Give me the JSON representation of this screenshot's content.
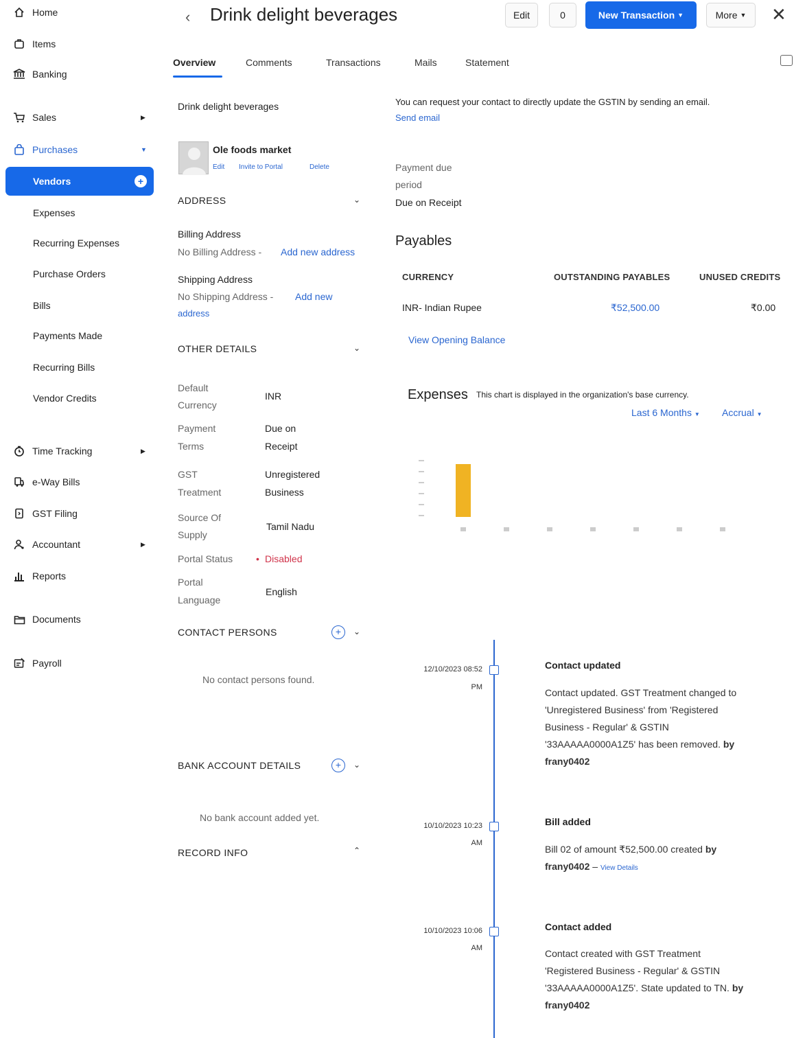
{
  "sidebar": {
    "items": [
      {
        "label": "Home",
        "icon": "home-icon"
      },
      {
        "label": "Items",
        "icon": "box-icon"
      },
      {
        "label": "Banking",
        "icon": "bank-icon"
      },
      {
        "label": "Sales",
        "icon": "cart-icon"
      },
      {
        "label": "Purchases",
        "icon": "bag-icon"
      },
      {
        "label": "Vendors"
      },
      {
        "label": "Expenses"
      },
      {
        "label": "Recurring Expenses"
      },
      {
        "label": "Purchase Orders"
      },
      {
        "label": "Bills"
      },
      {
        "label": "Payments Made"
      },
      {
        "label": "Recurring Bills"
      },
      {
        "label": "Vendor Credits"
      },
      {
        "label": "Time Tracking",
        "icon": "clock-icon"
      },
      {
        "label": "e-Way Bills",
        "icon": "truck-icon"
      },
      {
        "label": "GST Filing",
        "icon": "file-icon"
      },
      {
        "label": "Accountant",
        "icon": "person-icon"
      },
      {
        "label": "Reports",
        "icon": "bar-chart-icon"
      },
      {
        "label": "Documents",
        "icon": "folder-icon"
      },
      {
        "label": "Payroll",
        "icon": "payroll-icon"
      }
    ]
  },
  "header": {
    "title": "Drink delight beverages",
    "edit_label": "Edit",
    "attach_label": "0",
    "new_transaction_label": "New Transaction",
    "more_label": "More"
  },
  "tabs": [
    "Overview",
    "Comments",
    "Transactions",
    "Mails",
    "Statement"
  ],
  "profile": {
    "company": "Drink delight beverages",
    "contact_name": "Ole foods market",
    "actions": [
      "Edit",
      "Invite to Portal",
      "Delete"
    ]
  },
  "address": {
    "heading": "ADDRESS",
    "billing_label": "Billing Address",
    "billing_none": "No Billing Address -",
    "billing_add": "Add new address",
    "shipping_label": "Shipping Address",
    "shipping_none": "No Shipping Address -",
    "shipping_add_1": "Add new",
    "shipping_add_2": "address"
  },
  "other_details": {
    "heading": "OTHER DETAILS",
    "rows": [
      {
        "label1": "Default",
        "label2": "Currency",
        "value1": "INR",
        "value2": ""
      },
      {
        "label1": "Payment",
        "label2": "Terms",
        "value1": "Due on",
        "value2": "Receipt"
      },
      {
        "label1": "GST",
        "label2": "Treatment",
        "value1": "Unregistered",
        "value2": "Business"
      },
      {
        "label1": "Source Of",
        "label2": "Supply",
        "value1": "Tamil Nadu",
        "value2": ""
      },
      {
        "label1": "Portal Status",
        "label2": "",
        "value1": "Disabled",
        "value2": ""
      },
      {
        "label1": "Portal",
        "label2": "Language",
        "value1": "English",
        "value2": ""
      }
    ]
  },
  "contact_persons": {
    "heading": "CONTACT PERSONS",
    "empty": "No contact persons found."
  },
  "bank_accounts": {
    "heading": "BANK ACCOUNT DETAILS",
    "empty": "No bank account added yet."
  },
  "record_info": {
    "heading": "RECORD INFO"
  },
  "gstin_notice": {
    "text": "You can request your contact to directly update the GSTIN by sending an email.",
    "link": "Send email"
  },
  "payment_due": {
    "label1": "Payment due",
    "label2": "period",
    "value": "Due on Receipt"
  },
  "payables": {
    "heading": "Payables",
    "columns": [
      "CURRENCY",
      "OUTSTANDING PAYABLES",
      "UNUSED CREDITS"
    ],
    "row": {
      "currency": "INR- Indian Rupee",
      "outstanding": "₹52,500.00",
      "unused": "₹0.00"
    },
    "opening_balance_link": "View Opening Balance"
  },
  "expenses": {
    "heading": "Expenses",
    "note": "This chart is displayed in the organization's base currency.",
    "period_filter": "Last 6 Months",
    "basis_filter": "Accrual"
  },
  "chart_data": {
    "type": "bar",
    "categories": [
      "",
      "",
      "",
      "",
      "",
      "",
      ""
    ],
    "values": [
      52500,
      0,
      0,
      0,
      0,
      0,
      0
    ],
    "color": "#f0b323",
    "ylim": [
      0,
      60000
    ],
    "grid": false
  },
  "timeline": [
    {
      "date1": "12/10/2023 08:52",
      "date2": "PM",
      "title": "Contact updated",
      "body": "Contact updated. GST Treatment changed to 'Unregistered Business' from 'Registered Business - Regular' & GSTIN '33AAAAA0000A1Z5' has been removed.",
      "by": "by frany0402"
    },
    {
      "date1": "10/10/2023 10:23",
      "date2": "AM",
      "title": "Bill added",
      "body": "Bill 02 of amount ₹52,500.00 created",
      "by": "by frany0402",
      "link": "View Details"
    },
    {
      "date1": "10/10/2023 10:06",
      "date2": "AM",
      "title": "Contact added",
      "body": "Contact created with GST Treatment 'Registered Business - Regular' & GSTIN '33AAAAA0000A1Z5'. State updated to TN.",
      "by": "by frany0402"
    }
  ],
  "colors": {
    "accent": "#1769e8",
    "link": "#2a66d0",
    "danger": "#d0334a",
    "bar": "#f0b323"
  }
}
